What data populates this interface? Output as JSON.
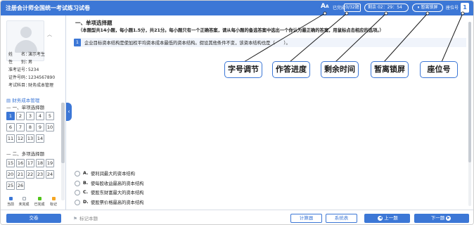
{
  "header": {
    "title": "注册会计师全国统一考试练习试卷",
    "font_icon": "A",
    "font_icon_small": "A",
    "progress_label": "已完成",
    "progress_value": "0/32题",
    "timer_label": "剩余",
    "timer_value": "02：29：54",
    "lock_label": "暂离锁屏",
    "seat_label": "座位号",
    "seat_value": "1"
  },
  "sidebar": {
    "info": [
      {
        "key": "姓　　名：",
        "value": "演示考生"
      },
      {
        "key": "性　　别：",
        "value": "男"
      },
      {
        "key": "准考证号：",
        "value": "5234"
      },
      {
        "key": "证件号码：",
        "value": "1234567890"
      },
      {
        "key": "考试科目：",
        "value": "财务成本管理"
      }
    ],
    "category": "财务成本管理",
    "section1_title": "一、单项选择题",
    "section1_items": [
      "1",
      "2",
      "3",
      "4",
      "5",
      "6",
      "7",
      "8",
      "9",
      "10",
      "11",
      "12",
      "13",
      "14"
    ],
    "section2_title": "二、多项选择题",
    "section2_items": [
      "15",
      "16",
      "17",
      "18",
      "19",
      "20",
      "21",
      "22",
      "23",
      "24",
      "25",
      "26"
    ],
    "legend": [
      {
        "label": "当前",
        "color": "#3c77d6"
      },
      {
        "label": "未完成",
        "color": "#ffffff"
      },
      {
        "label": "已完成",
        "color": "#52c41a"
      },
      {
        "label": "标记",
        "color": "#f5a623"
      }
    ]
  },
  "main": {
    "section_heading": "一、单项选择题",
    "section_desc": "（本题型共14小题，每小题1.5分，共21分。每小题只有一个正确答案，请从每小题的备选答案中选出一个你认为最正确的答案，用鼠标点击相应的选项。）",
    "question_number": "1",
    "question_text": "企业目标资本结构是使加权平均资本成本最低的资本结构。假设其他条件不变，该资本结构也是（　　）。",
    "options": [
      {
        "letter": "A.",
        "text": "使利润最大的资本结构"
      },
      {
        "letter": "B.",
        "text": "使每股收益最高的资本结构"
      },
      {
        "letter": "C.",
        "text": "使股东财富最大的资本结构"
      },
      {
        "letter": "D.",
        "text": "使股票价格最高的资本结构"
      }
    ]
  },
  "callouts": [
    "字号调节",
    "作答进度",
    "剩余时间",
    "暂离锁屏",
    "座位号"
  ],
  "footer": {
    "submit": "交卷",
    "mark": "标记本题",
    "calculator": "计算器",
    "notebook": "系统表",
    "prev": "上一题",
    "next": "下一题"
  }
}
